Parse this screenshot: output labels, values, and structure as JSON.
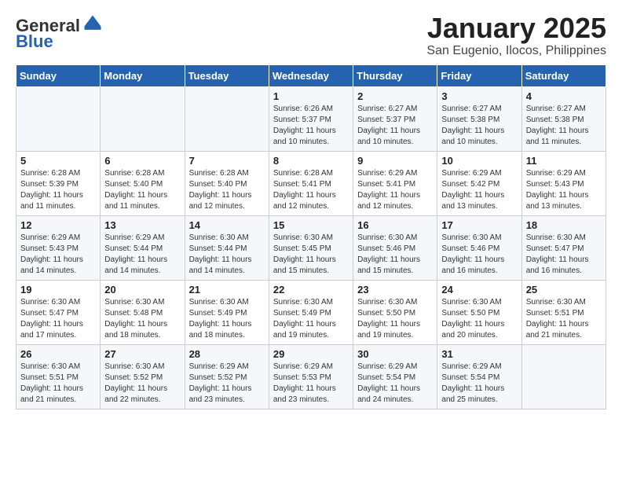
{
  "logo": {
    "general": "General",
    "blue": "Blue"
  },
  "header": {
    "month": "January 2025",
    "location": "San Eugenio, Ilocos, Philippines"
  },
  "weekdays": [
    "Sunday",
    "Monday",
    "Tuesday",
    "Wednesday",
    "Thursday",
    "Friday",
    "Saturday"
  ],
  "weeks": [
    [
      {
        "day": "",
        "info": ""
      },
      {
        "day": "",
        "info": ""
      },
      {
        "day": "",
        "info": ""
      },
      {
        "day": "1",
        "info": "Sunrise: 6:26 AM\nSunset: 5:37 PM\nDaylight: 11 hours and 10 minutes."
      },
      {
        "day": "2",
        "info": "Sunrise: 6:27 AM\nSunset: 5:37 PM\nDaylight: 11 hours and 10 minutes."
      },
      {
        "day": "3",
        "info": "Sunrise: 6:27 AM\nSunset: 5:38 PM\nDaylight: 11 hours and 10 minutes."
      },
      {
        "day": "4",
        "info": "Sunrise: 6:27 AM\nSunset: 5:38 PM\nDaylight: 11 hours and 11 minutes."
      }
    ],
    [
      {
        "day": "5",
        "info": "Sunrise: 6:28 AM\nSunset: 5:39 PM\nDaylight: 11 hours and 11 minutes."
      },
      {
        "day": "6",
        "info": "Sunrise: 6:28 AM\nSunset: 5:40 PM\nDaylight: 11 hours and 11 minutes."
      },
      {
        "day": "7",
        "info": "Sunrise: 6:28 AM\nSunset: 5:40 PM\nDaylight: 11 hours and 12 minutes."
      },
      {
        "day": "8",
        "info": "Sunrise: 6:28 AM\nSunset: 5:41 PM\nDaylight: 11 hours and 12 minutes."
      },
      {
        "day": "9",
        "info": "Sunrise: 6:29 AM\nSunset: 5:41 PM\nDaylight: 11 hours and 12 minutes."
      },
      {
        "day": "10",
        "info": "Sunrise: 6:29 AM\nSunset: 5:42 PM\nDaylight: 11 hours and 13 minutes."
      },
      {
        "day": "11",
        "info": "Sunrise: 6:29 AM\nSunset: 5:43 PM\nDaylight: 11 hours and 13 minutes."
      }
    ],
    [
      {
        "day": "12",
        "info": "Sunrise: 6:29 AM\nSunset: 5:43 PM\nDaylight: 11 hours and 14 minutes."
      },
      {
        "day": "13",
        "info": "Sunrise: 6:29 AM\nSunset: 5:44 PM\nDaylight: 11 hours and 14 minutes."
      },
      {
        "day": "14",
        "info": "Sunrise: 6:30 AM\nSunset: 5:44 PM\nDaylight: 11 hours and 14 minutes."
      },
      {
        "day": "15",
        "info": "Sunrise: 6:30 AM\nSunset: 5:45 PM\nDaylight: 11 hours and 15 minutes."
      },
      {
        "day": "16",
        "info": "Sunrise: 6:30 AM\nSunset: 5:46 PM\nDaylight: 11 hours and 15 minutes."
      },
      {
        "day": "17",
        "info": "Sunrise: 6:30 AM\nSunset: 5:46 PM\nDaylight: 11 hours and 16 minutes."
      },
      {
        "day": "18",
        "info": "Sunrise: 6:30 AM\nSunset: 5:47 PM\nDaylight: 11 hours and 16 minutes."
      }
    ],
    [
      {
        "day": "19",
        "info": "Sunrise: 6:30 AM\nSunset: 5:47 PM\nDaylight: 11 hours and 17 minutes."
      },
      {
        "day": "20",
        "info": "Sunrise: 6:30 AM\nSunset: 5:48 PM\nDaylight: 11 hours and 18 minutes."
      },
      {
        "day": "21",
        "info": "Sunrise: 6:30 AM\nSunset: 5:49 PM\nDaylight: 11 hours and 18 minutes."
      },
      {
        "day": "22",
        "info": "Sunrise: 6:30 AM\nSunset: 5:49 PM\nDaylight: 11 hours and 19 minutes."
      },
      {
        "day": "23",
        "info": "Sunrise: 6:30 AM\nSunset: 5:50 PM\nDaylight: 11 hours and 19 minutes."
      },
      {
        "day": "24",
        "info": "Sunrise: 6:30 AM\nSunset: 5:50 PM\nDaylight: 11 hours and 20 minutes."
      },
      {
        "day": "25",
        "info": "Sunrise: 6:30 AM\nSunset: 5:51 PM\nDaylight: 11 hours and 21 minutes."
      }
    ],
    [
      {
        "day": "26",
        "info": "Sunrise: 6:30 AM\nSunset: 5:51 PM\nDaylight: 11 hours and 21 minutes."
      },
      {
        "day": "27",
        "info": "Sunrise: 6:30 AM\nSunset: 5:52 PM\nDaylight: 11 hours and 22 minutes."
      },
      {
        "day": "28",
        "info": "Sunrise: 6:29 AM\nSunset: 5:52 PM\nDaylight: 11 hours and 23 minutes."
      },
      {
        "day": "29",
        "info": "Sunrise: 6:29 AM\nSunset: 5:53 PM\nDaylight: 11 hours and 23 minutes."
      },
      {
        "day": "30",
        "info": "Sunrise: 6:29 AM\nSunset: 5:54 PM\nDaylight: 11 hours and 24 minutes."
      },
      {
        "day": "31",
        "info": "Sunrise: 6:29 AM\nSunset: 5:54 PM\nDaylight: 11 hours and 25 minutes."
      },
      {
        "day": "",
        "info": ""
      }
    ]
  ]
}
